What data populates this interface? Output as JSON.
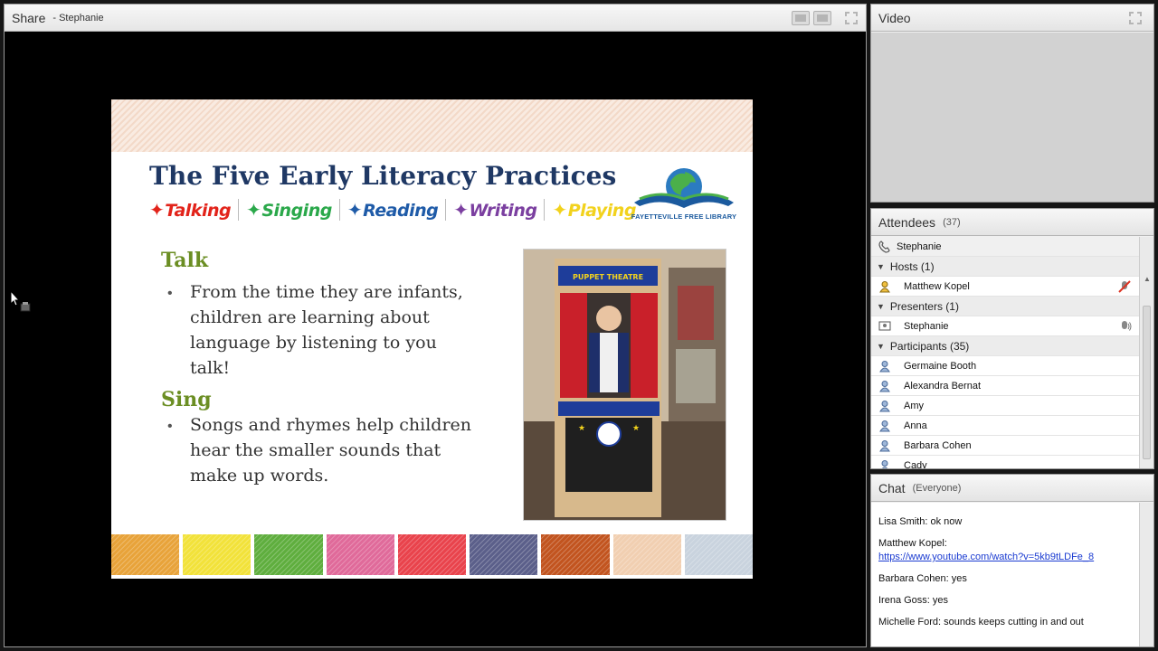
{
  "share_pod": {
    "title": "Share",
    "presenter": "- Stephanie"
  },
  "slide": {
    "title": "The Five Early Literacy Practices",
    "practices": [
      "Talking",
      "Singing",
      "Reading",
      "Writing",
      "Playing"
    ],
    "library_name": "FAYETTEVILLE FREE LIBRARY",
    "sections": [
      {
        "heading": "Talk",
        "lines": [
          "From the time they are infants,",
          "children are learning about",
          "language by listening to you",
          "talk!"
        ]
      },
      {
        "heading": "Sing",
        "lines": [
          "Songs and rhymes help children",
          "hear the smaller sounds that",
          "make up words."
        ]
      }
    ],
    "photo_sign": "PUPPET THEATRE",
    "swatch_colors": [
      "#e8a33a",
      "#f2e23a",
      "#5fae3e",
      "#e06a9a",
      "#e9434c",
      "#5b5f8a",
      "#c2541f",
      "#f1cfb1",
      "#c9d3de"
    ]
  },
  "video_pod": {
    "title": "Video"
  },
  "attendees_pod": {
    "title": "Attendees",
    "count": "(37)",
    "self": "Stephanie",
    "hosts_label": "Hosts (1)",
    "hosts": [
      "Matthew Kopel"
    ],
    "presenters_label": "Presenters (1)",
    "presenters": [
      "Stephanie"
    ],
    "participants_label": "Participants (35)",
    "participants": [
      "Germaine Booth",
      "Alexandra Bernat",
      "Amy",
      "Anna",
      "Barbara Cohen",
      "Cady"
    ]
  },
  "chat_pod": {
    "title": "Chat",
    "scope": "(Everyone)",
    "messages": [
      {
        "who": "Lisa Smith:",
        "text": "ok now"
      },
      {
        "who": "Matthew Kopel:",
        "text": "https://www.youtube.com/watch?v=5kb9tLDFe_8"
      },
      {
        "who": "Barbara Cohen:",
        "text": "yes"
      },
      {
        "who": "Irena Goss:",
        "text": "yes"
      },
      {
        "who": "Michelle Ford:",
        "text": "sounds keeps cutting in and out"
      }
    ]
  }
}
